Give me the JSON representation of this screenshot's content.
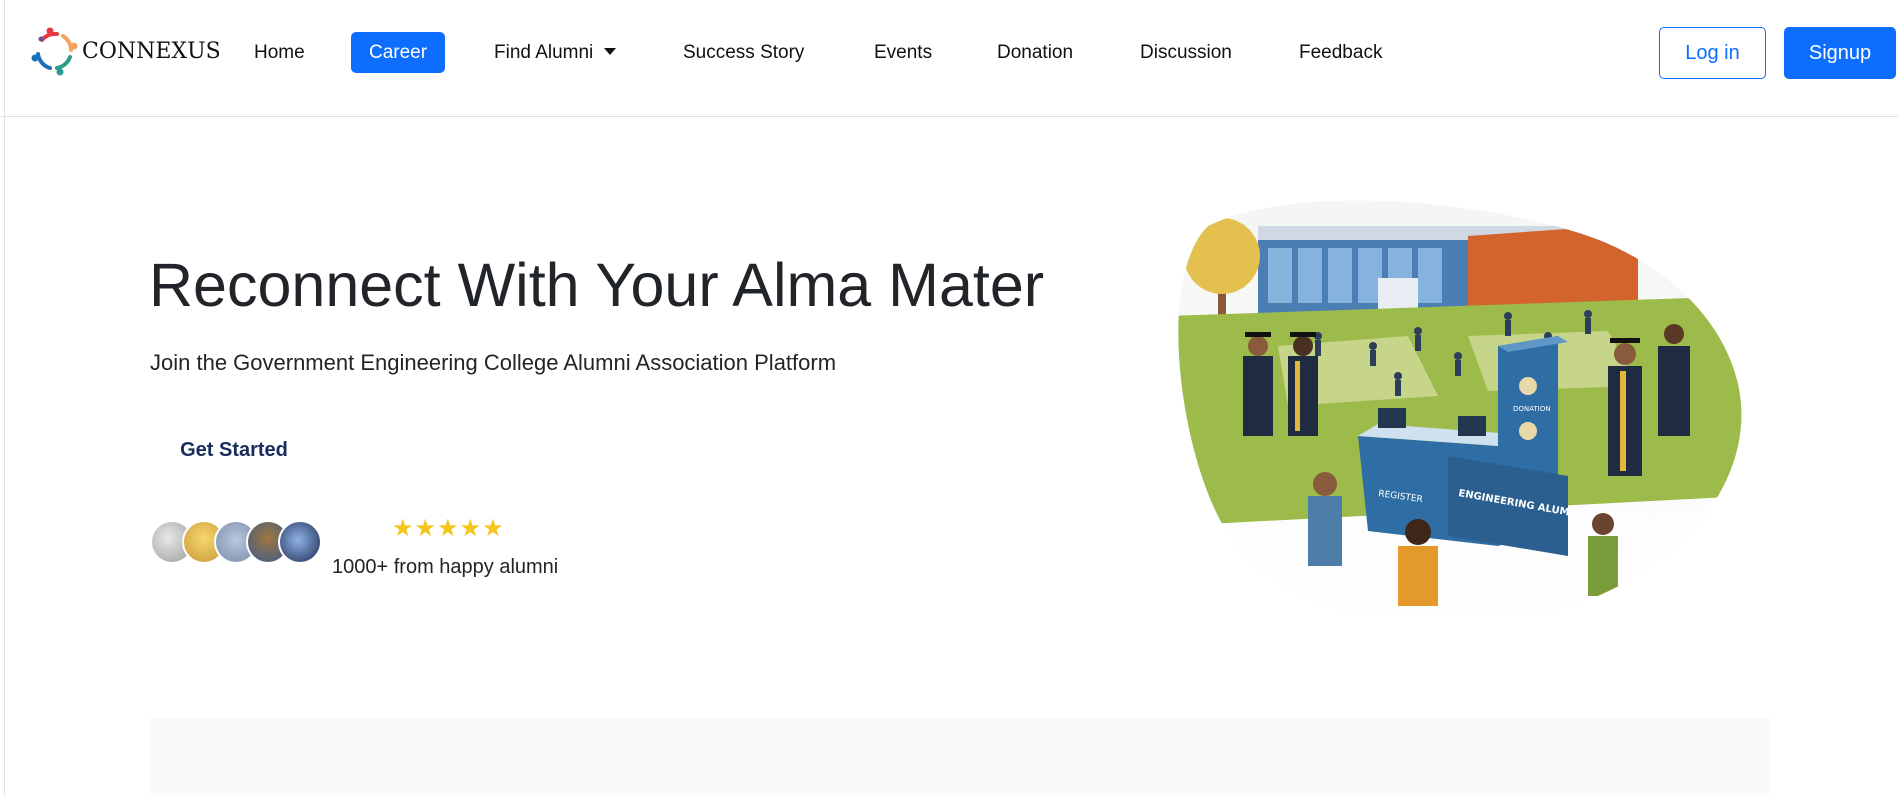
{
  "brand": {
    "name": "CONNEXUS",
    "logo_icon": "connexus-logo-icon"
  },
  "nav": {
    "items": [
      {
        "label": "Home"
      },
      {
        "label": "Career",
        "active": true
      },
      {
        "label": "Find Alumni",
        "dropdown": true
      },
      {
        "label": "Success Story"
      },
      {
        "label": "Events"
      },
      {
        "label": "Donation"
      },
      {
        "label": "Discussion"
      },
      {
        "label": "Feedback"
      }
    ],
    "login_label": "Log in",
    "signup_label": "Signup"
  },
  "hero": {
    "title": "Reconnect With Your Alma Mater",
    "subtitle": "Join the Government Engineering College Alumni Association Platform",
    "cta_label": "Get Started",
    "rating": "★★★★★",
    "review_text": "1000+ from happy alumni",
    "illustration": {
      "sign_main": "ENGINEERING ALUMNI ASSOCIATION",
      "sign_register": "REGISTER",
      "sign_donation": "DONATION"
    }
  },
  "colors": {
    "primary": "#0d6efd",
    "star": "#f5c518",
    "cta_text": "#1a2c5b"
  }
}
